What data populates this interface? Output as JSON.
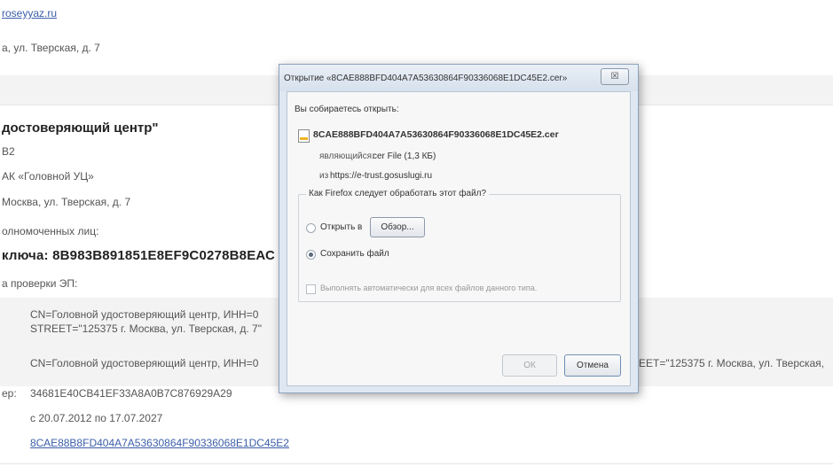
{
  "page": {
    "site_link": "roseyyaz.ru",
    "address_top": "а, ул. Тверская, д. 7",
    "org_heading": "достоверяющий центр\"",
    "code_line": "В2",
    "org_short": "АК «Головной УЦ»",
    "city_address": "Москва, ул. Тверская, д. 7",
    "authorized_label": "олномоченных лиц:",
    "key_heading": "ключа: 8В983В891851Е8ЕF9С0278В8ЕАС",
    "check_label": "а проверки ЭП:",
    "dn_line1": "CN=Головной удостоверяющий центр, ИНН=0",
    "dn_line2": "STREET=\"125375 г. Москва, ул. Тверская, д. 7\"",
    "dn_line3": "CN=Головной удостоверяющий центр, ИНН=0",
    "dn_line3_right": "EET=\"125375 г. Москва, ул. Тверская,",
    "serial_prefix": "ер:",
    "serial_value": "34681Е40СВ41ЕF33А8А0В7С876929А29",
    "validity": "с 20.07.2012 по 17.07.2027",
    "cert_link": "8САЕ88В8FD404А7А53630864F90336068E1DC45E2"
  },
  "dialog": {
    "title": "Открытие «8CAE888BFD404A7A53630864F90336068E1DC45E2.cer»",
    "close_label": "☒",
    "intro": "Вы собираетесь открыть:",
    "filename": "8CAE888BFD404A7A53630864F90336068E1DC45E2.cer",
    "type_label": "являющийся:",
    "type_value": "cer File (1,3 КБ)",
    "from_label": "из",
    "from_value": "https://e-trust.gosuslugi.ru",
    "question": "Как Firefox следует обработать этот файл?",
    "open_with_label": "Открыть в",
    "browse_label": "Обзор...",
    "save_label": "Сохранить файл",
    "auto_label": "Выполнять автоматически для всех файлов данного типа.",
    "ok_label": "ОК",
    "cancel_label": "Отмена"
  }
}
